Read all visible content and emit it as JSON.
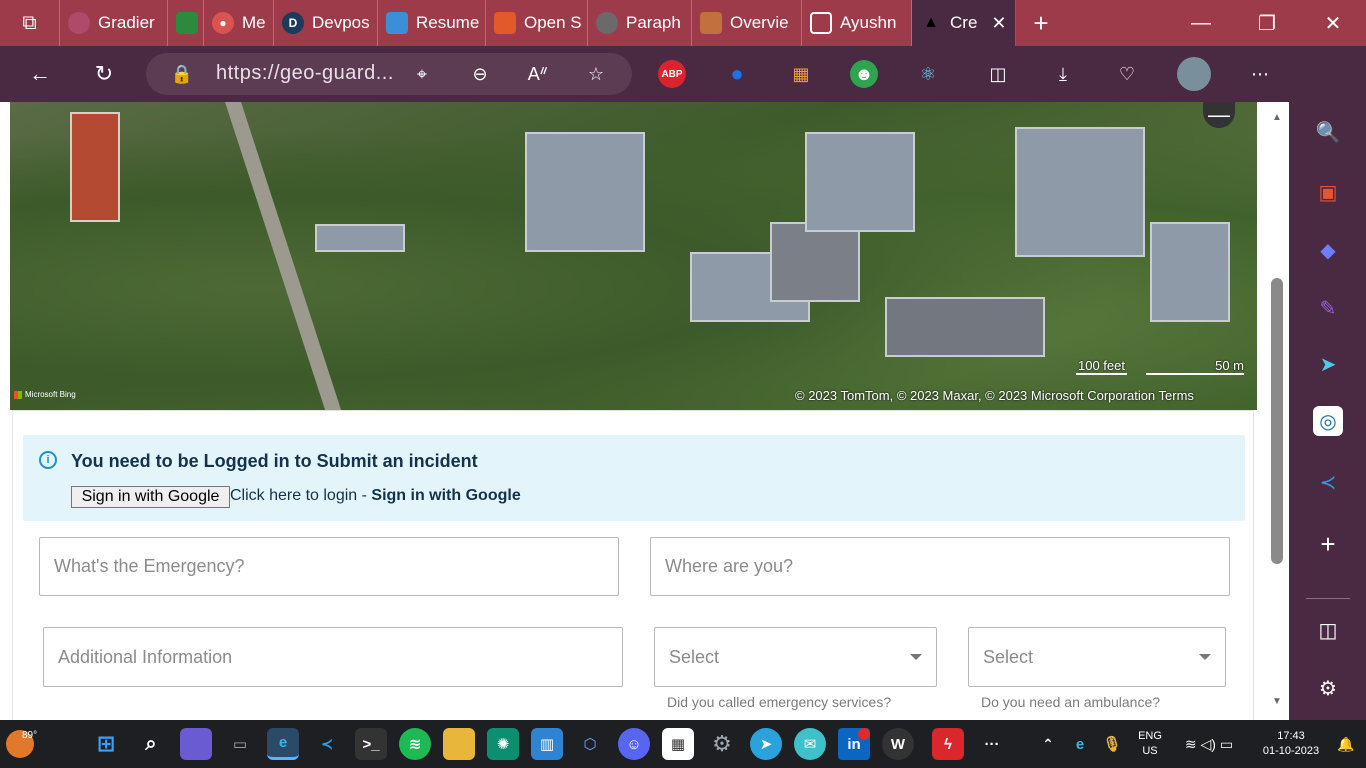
{
  "browser": {
    "tabs": [
      {
        "label": "Gradier",
        "color": "#b04a6a"
      },
      {
        "label": "",
        "color": "#2b8a3e"
      },
      {
        "label": "Me",
        "color": "#d9534f"
      },
      {
        "label": "Devpos",
        "color": "#1b3a5c"
      },
      {
        "label": "Resume",
        "color": "#3b8fd9"
      },
      {
        "label": "Open S",
        "color": "#e25a2a"
      },
      {
        "label": "Paraph",
        "color": "#6a6a6a"
      },
      {
        "label": "Overvie",
        "color": "#c2703d"
      },
      {
        "label": "Ayushn",
        "color": "#ffffff"
      },
      {
        "label": "Cre",
        "color": "#000000"
      }
    ],
    "url": "https://geo-guard...",
    "abp_label": "ABP",
    "sidebar_icons": [
      "search-icon",
      "briefcase-icon",
      "copilot-icon",
      "designer-icon",
      "send-icon",
      "shield-icon",
      "vscode-icon",
      "add-icon",
      "split-screen-icon",
      "settings-icon"
    ]
  },
  "map": {
    "zoom_out_label": "—",
    "scale_feet": "100 feet",
    "scale_meters": "50 m",
    "attribution": "© 2023 TomTom, © 2023 Maxar, © 2023 Microsoft Corporation  Terms",
    "provider": "Microsoft Bing"
  },
  "form": {
    "alert_title": "You need to be Logged in to Submit an incident",
    "google_button": "Sign in with Google",
    "login_prefix": "Click here to login - ",
    "login_link": "Sign in with Google",
    "emergency_placeholder": "What's the Emergency?",
    "location_placeholder": "Where are you?",
    "additional_placeholder": "Additional Information",
    "select1": "Select",
    "select1_hint": "Did you called emergency services?",
    "select2": "Select",
    "select2_hint": "Do you need an ambulance?"
  },
  "taskbar": {
    "weather": "89°",
    "lang_top": "ENG",
    "lang_bottom": "US",
    "time": "17:43",
    "date": "01-10-2023"
  }
}
